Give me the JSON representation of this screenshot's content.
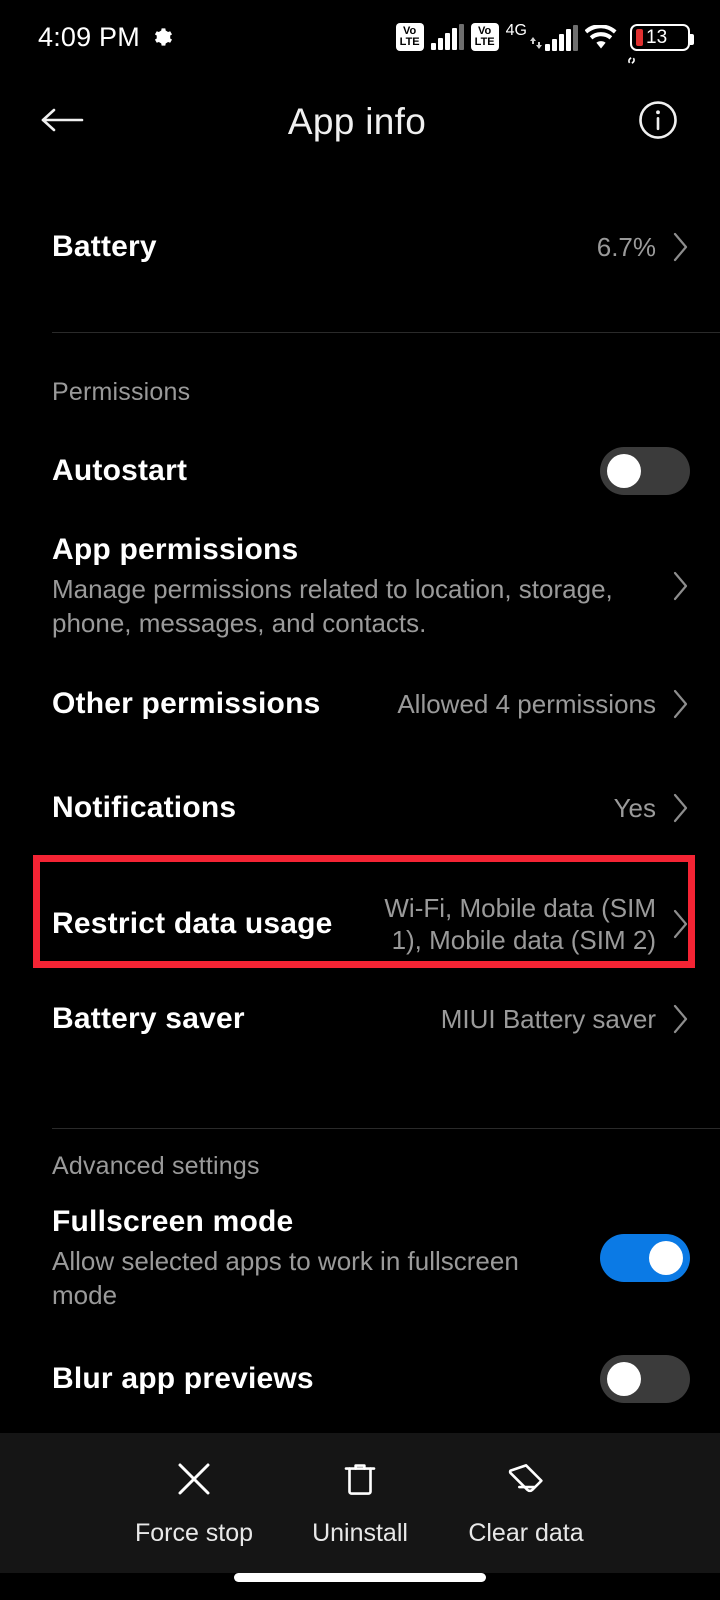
{
  "status_bar": {
    "time": "4:09 PM",
    "gear_icon": "gear-icon",
    "volte_top": "Vo",
    "volte_bottom": "LTE",
    "network_label": "4G",
    "wifi_icon": "wifi-icon",
    "link_icon": "link-icon",
    "battery_level": "13"
  },
  "app_bar": {
    "back_icon": "back-arrow-icon",
    "title": "App info",
    "info_icon": "info-icon"
  },
  "content": {
    "battery_row": {
      "title": "Battery",
      "value": "6.7%"
    },
    "permissions_section_label": "Permissions",
    "autostart_row": {
      "title": "Autostart",
      "toggle_state": "off"
    },
    "app_permissions_row": {
      "title": "App permissions",
      "subtitle": "Manage permissions related to location, storage, phone, messages, and contacts."
    },
    "other_permissions_row": {
      "title": "Other permissions",
      "value": "Allowed 4 permissions"
    },
    "notifications_row": {
      "title": "Notifications",
      "value": "Yes"
    },
    "restrict_data_usage_row": {
      "title": "Restrict data usage",
      "value": "Wi-Fi, Mobile data (SIM 1), Mobile data (SIM 2)",
      "highlighted": true
    },
    "battery_saver_row": {
      "title": "Battery saver",
      "value": "MIUI Battery saver"
    },
    "advanced_section_label": "Advanced settings",
    "fullscreen_mode_row": {
      "title": "Fullscreen mode",
      "subtitle": "Allow selected apps to work in fullscreen mode",
      "toggle_state": "on"
    },
    "blur_app_previews_row": {
      "title": "Blur app previews",
      "toggle_state": "off"
    }
  },
  "action_bar": {
    "actions": [
      {
        "label": "Force stop",
        "icon": "close-x-icon"
      },
      {
        "label": "Uninstall",
        "icon": "trash-icon"
      },
      {
        "label": "Clear data",
        "icon": "eraser-icon"
      }
    ]
  },
  "colors": {
    "background": "#000000",
    "accent_blue": "#0b7ae5",
    "highlight_red": "#f42434",
    "secondary_text": "#9a9a9a",
    "action_bar_bg": "#151515"
  }
}
